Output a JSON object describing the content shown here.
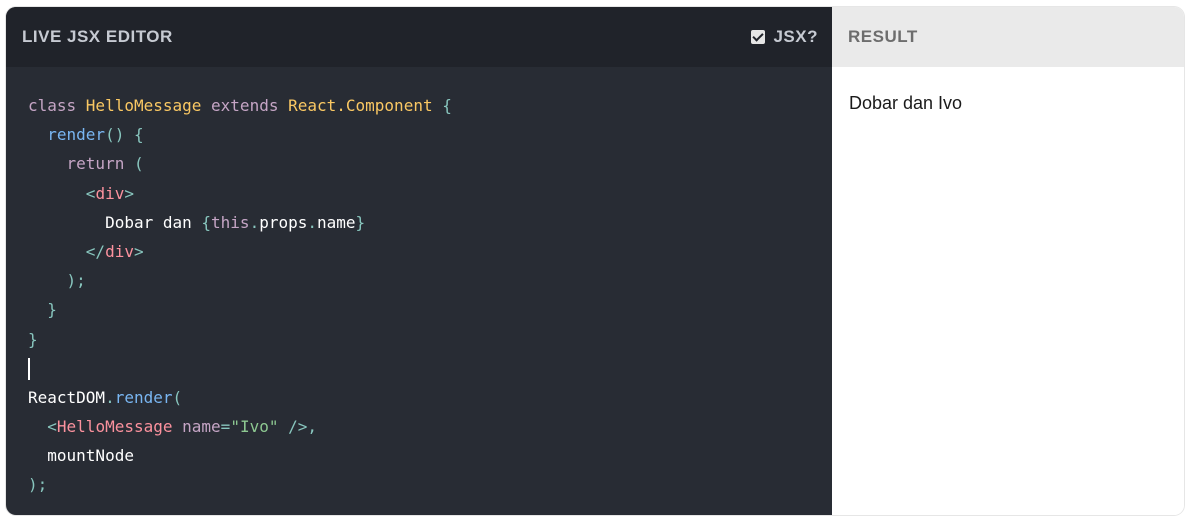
{
  "editor": {
    "title": "LIVE JSX EDITOR",
    "jsx_toggle_label": "JSX?",
    "jsx_checked": true
  },
  "code": {
    "lines": [
      [
        [
          "kw",
          "class "
        ],
        [
          "cls",
          "HelloMessage "
        ],
        [
          "kw",
          "extends "
        ],
        [
          "cls",
          "React.Component "
        ],
        [
          "punc",
          "{"
        ]
      ],
      [
        [
          "txt",
          "  "
        ],
        [
          "fn",
          "render"
        ],
        [
          "punc",
          "() {"
        ]
      ],
      [
        [
          "txt",
          "    "
        ],
        [
          "kw",
          "return "
        ],
        [
          "punc",
          "("
        ]
      ],
      [
        [
          "txt",
          "      "
        ],
        [
          "punc",
          "<"
        ],
        [
          "tag",
          "div"
        ],
        [
          "punc",
          ">"
        ]
      ],
      [
        [
          "txt",
          "        Dobar dan "
        ],
        [
          "punc",
          "{"
        ],
        [
          "kw",
          "this"
        ],
        [
          "punc",
          "."
        ],
        [
          "txt",
          "props"
        ],
        [
          "punc",
          "."
        ],
        [
          "txt",
          "name"
        ],
        [
          "punc",
          "}"
        ]
      ],
      [
        [
          "txt",
          "      "
        ],
        [
          "punc",
          "</"
        ],
        [
          "tag",
          "div"
        ],
        [
          "punc",
          ">"
        ]
      ],
      [
        [
          "txt",
          "    "
        ],
        [
          "punc",
          ");"
        ]
      ],
      [
        [
          "txt",
          "  "
        ],
        [
          "punc",
          "}"
        ]
      ],
      [
        [
          "punc",
          "}"
        ]
      ],
      [
        [
          "caret",
          ""
        ]
      ],
      [
        [
          "txt",
          "ReactDOM"
        ],
        [
          "punc",
          "."
        ],
        [
          "fn",
          "render"
        ],
        [
          "punc",
          "("
        ]
      ],
      [
        [
          "txt",
          "  "
        ],
        [
          "punc",
          "<"
        ],
        [
          "tag",
          "HelloMessage "
        ],
        [
          "attr",
          "name"
        ],
        [
          "punc",
          "="
        ],
        [
          "str",
          "\"Ivo\""
        ],
        [
          "punc",
          " />,"
        ]
      ],
      [
        [
          "txt",
          "  mountNode"
        ]
      ],
      [
        [
          "punc",
          ");"
        ]
      ]
    ]
  },
  "result": {
    "title": "RESULT",
    "output": "Dobar dan Ivo"
  },
  "colors": {
    "editor_bg": "#282c34",
    "editor_header_bg": "#20232a",
    "result_header_bg": "#eaeaea"
  }
}
